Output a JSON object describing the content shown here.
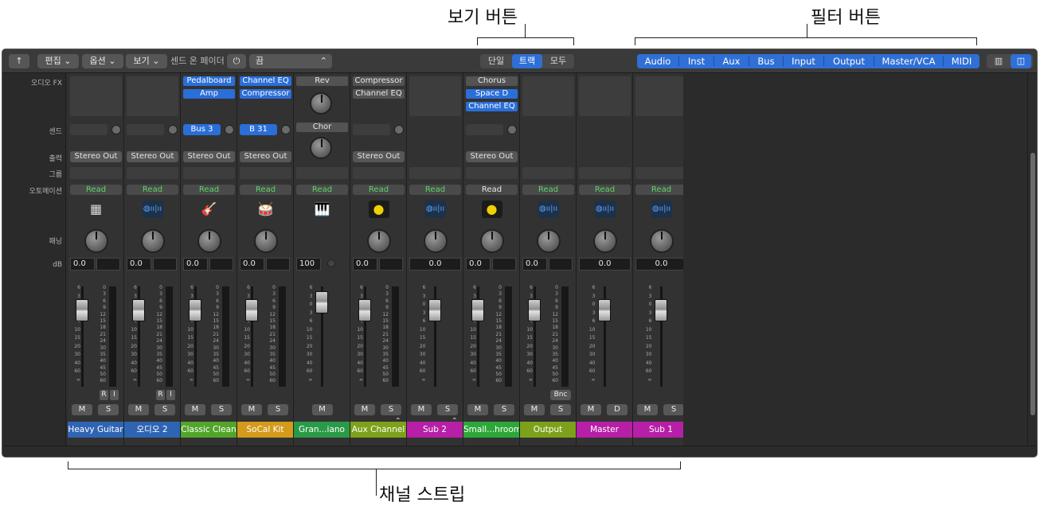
{
  "callouts": {
    "view_buttons": "보기 버튼",
    "filter_buttons": "필터 버튼",
    "channel_strips": "채널 스트립"
  },
  "toolbar": {
    "edit": "편집",
    "options": "옵션",
    "view": "보기",
    "send_fader": "센드 온 페이더",
    "send_value": "끔",
    "view_modes": [
      "단일",
      "트랙",
      "모두"
    ],
    "view_selected": "트랙",
    "filters": [
      "Audio",
      "Inst",
      "Aux",
      "Bus",
      "Input",
      "Output",
      "Master/VCA",
      "MIDI"
    ]
  },
  "row_labels": {
    "audio_fx": "오디오 FX",
    "sends": "센드",
    "output": "출력",
    "group": "그룹",
    "automation": "오토메이션",
    "pan": "패닝",
    "db": "dB"
  },
  "meter_ticks": [
    "0",
    "3",
    "6",
    "9",
    "12",
    "15",
    "18",
    "21",
    "24",
    "30",
    "35",
    "40",
    "45",
    "50",
    "60"
  ],
  "fader_scale": [
    "6",
    "3",
    "0",
    "3",
    "6",
    "10",
    "15",
    "20",
    "30",
    "40",
    "60",
    "∞"
  ],
  "strips": [
    {
      "name": "Heavy Guitar",
      "color": "#2f64b3",
      "fx": [],
      "send": "",
      "output": "Stereo Out",
      "auto": "Read",
      "icon": "amp",
      "db": "0.0",
      "buttons": [
        "M",
        "S"
      ],
      "ri": true
    },
    {
      "name": "오디오 2",
      "color": "#2f64b3",
      "fx": [],
      "send": "",
      "output": "Stereo Out",
      "auto": "Read",
      "icon": "waveform",
      "db": "0.0",
      "buttons": [
        "M",
        "S"
      ],
      "ri": true
    },
    {
      "name": "Classic Clean",
      "color": "#52a52a",
      "fx": [
        "Pedalboard",
        "Amp"
      ],
      "send": "Bus 3",
      "output": "Stereo Out",
      "auto": "Read",
      "icon": "guitar",
      "db": "0.0",
      "buttons": [
        "M",
        "S"
      ]
    },
    {
      "name": "SoCal Kit",
      "color": "#d49a1a",
      "fx": [
        "Channel EQ",
        "Compressor"
      ],
      "send": "B 31",
      "output": "Stereo Out",
      "auto": "Read",
      "icon": "drums",
      "db": "0.0",
      "buttons": [
        "M",
        "S"
      ]
    },
    {
      "name": "Gran...iano",
      "color": "#2b9a48",
      "fx": [
        "Rev"
      ],
      "fx2": "Chor",
      "send": "",
      "output": "",
      "auto": "Read",
      "icon": "piano",
      "db": "100",
      "buttons": [
        "M"
      ]
    },
    {
      "name": "Aux Channel",
      "color": "#7da11b",
      "fx": [
        "Compressor",
        "Channel EQ"
      ],
      "send": "",
      "output": "Stereo Out",
      "auto": "Read",
      "icon": "dial",
      "db": "0.0",
      "buttons": [
        "M",
        "S"
      ]
    },
    {
      "name": "Sub 2",
      "color": "#b71fa6",
      "fx": [],
      "send": "",
      "output": "",
      "auto": "Read",
      "icon": "waveform",
      "db": "0.0",
      "buttons": [
        "M",
        "S"
      ]
    },
    {
      "name": "Small...hroom",
      "color": "#2ca838",
      "fx": [
        "Chorus",
        "Space D",
        "Channel EQ"
      ],
      "send": "",
      "output": "Stereo Out",
      "auto": "Read",
      "icon": "dial",
      "db": "0.0",
      "buttons": [
        "M",
        "S"
      ]
    },
    {
      "name": "Output",
      "color": "#7da11b",
      "fx": [],
      "send": "",
      "output": "",
      "auto": "Read",
      "icon": "waveform",
      "db": "0.0",
      "buttons": [
        "M",
        "S"
      ],
      "bnc": "Bnc"
    },
    {
      "name": "Master",
      "color": "#b71fa6",
      "fx": [],
      "send": "",
      "output": "",
      "auto": "Read",
      "icon": "waveform",
      "db": "0.0",
      "buttons": [
        "M",
        "D"
      ]
    },
    {
      "name": "Sub 1",
      "color": "#b71fa6",
      "fx": [],
      "send": "",
      "output": "",
      "auto": "Read",
      "icon": "waveform",
      "db": "0.0",
      "buttons": [
        "M",
        "S"
      ]
    }
  ]
}
